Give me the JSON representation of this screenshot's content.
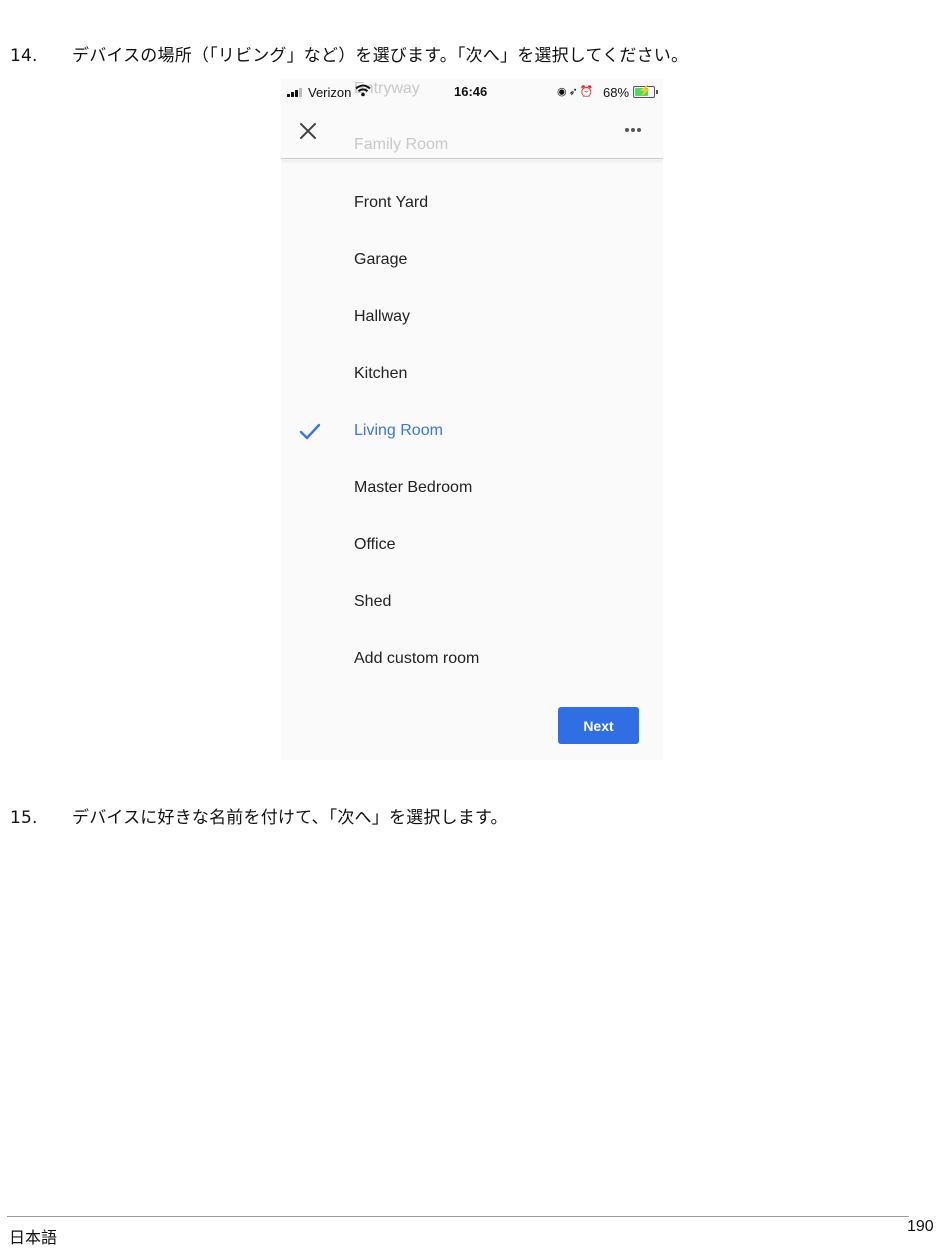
{
  "steps": [
    {
      "number": "14.",
      "text": "デバイスの場所（「リビング」など）を選びます。「次へ」を選択してください。"
    },
    {
      "number": "15.",
      "text": "デバイスに好きな名前を付けて、「次へ」を選択します。"
    }
  ],
  "phone": {
    "status_bar": {
      "carrier": "Verizon",
      "time": "16:46",
      "battery": "68%",
      "icons": [
        "signal-icon",
        "wifi-icon",
        "orientation-lock-icon",
        "location-icon",
        "alarm-icon",
        "battery-charging-icon"
      ]
    },
    "scrolled_behind_header": [
      "Entryway",
      "Family Room"
    ],
    "header_icons": [
      "close-icon",
      "more-options-icon"
    ],
    "rooms": [
      {
        "label": "Front Yard",
        "selected": false
      },
      {
        "label": "Garage",
        "selected": false
      },
      {
        "label": "Hallway",
        "selected": false
      },
      {
        "label": "Kitchen",
        "selected": false
      },
      {
        "label": "Living Room",
        "selected": true
      },
      {
        "label": "Master Bedroom",
        "selected": false
      },
      {
        "label": "Office",
        "selected": false
      },
      {
        "label": "Shed",
        "selected": false
      },
      {
        "label": "Add custom room",
        "selected": false
      }
    ],
    "next_label": "Next",
    "colors": {
      "accent": "#3b76d8",
      "button": "#2f6fe3"
    }
  },
  "footer": {
    "language": "日本語",
    "page": "190"
  }
}
